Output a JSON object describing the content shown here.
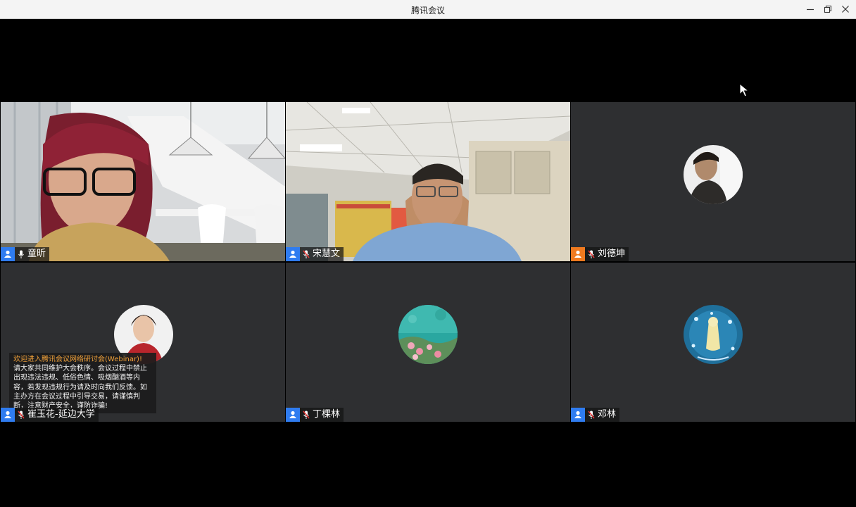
{
  "window": {
    "title": "腾讯会议",
    "controls": [
      {
        "name": "minimize-icon"
      },
      {
        "name": "restore-icon"
      },
      {
        "name": "close-icon"
      }
    ]
  },
  "participants": [
    {
      "name": "童昕",
      "mic": "on",
      "icon_color": "#2f7cf0",
      "speaking": true,
      "view": "video"
    },
    {
      "name": "宋慧文",
      "mic": "muted",
      "icon_color": "#2f7cf0",
      "view": "video"
    },
    {
      "name": "刘德坤",
      "mic": "muted",
      "icon_color": "#f07a1f",
      "view": "avatar"
    },
    {
      "name": "崔玉花-延边大学",
      "mic": "muted",
      "icon_color": "#2f7cf0",
      "view": "avatar"
    },
    {
      "name": "丁棵林",
      "mic": "muted",
      "icon_color": "#2f7cf0",
      "view": "avatar"
    },
    {
      "name": "邓林",
      "mic": "muted",
      "icon_color": "#2f7cf0",
      "view": "avatar"
    }
  ],
  "notice": {
    "headline": "欢迎进入腾讯会议网络研讨会(Webinar)!",
    "body": "请大家共同维护大会秩序。会议过程中禁止出现违法违规、低俗色情、吸烟酗酒等内容，若发现违规行为请及时向我们反馈。如主办方在会议过程中引导交易，请谨慎判断，注意财产安全，谨防诈骗!"
  },
  "colors": {
    "speaking_border": "#24b24a",
    "tile_bg": "#2e2f31",
    "notice_head": "#f2a23a"
  }
}
